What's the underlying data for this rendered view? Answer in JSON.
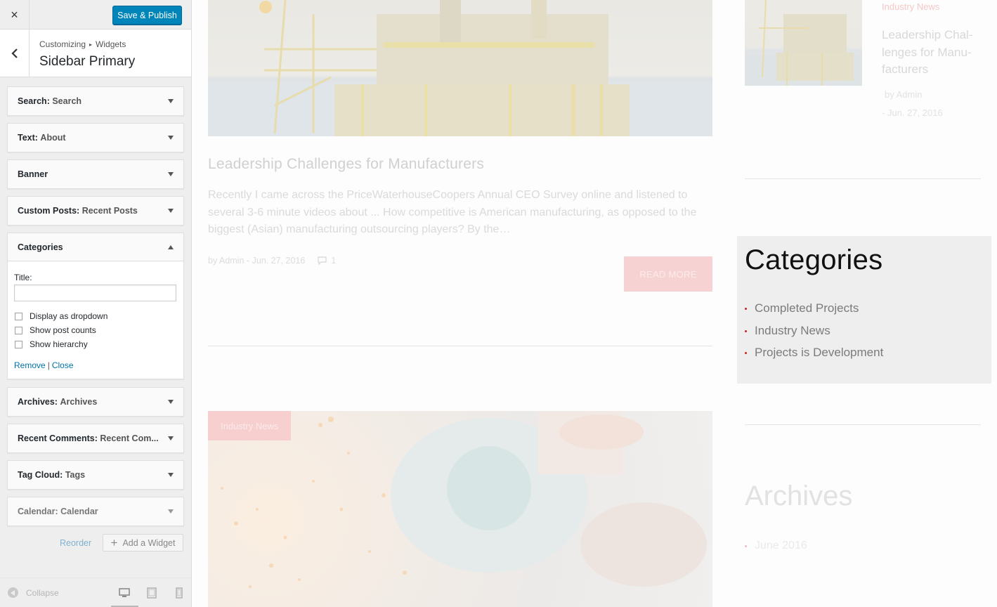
{
  "panel": {
    "header": {
      "close_label": "×",
      "save_label": "Save & Publish"
    },
    "breadcrumb": {
      "root": "Customizing",
      "separator": "▸",
      "current": "Widgets"
    },
    "section_title": "Sidebar Primary",
    "widgets": [
      {
        "type": "Search:",
        "title": "Search",
        "expanded": false
      },
      {
        "type": "Text:",
        "title": "About",
        "expanded": false
      },
      {
        "type": "Banner",
        "title": "",
        "expanded": false
      },
      {
        "type": "Custom Posts:",
        "title": "Recent Posts",
        "expanded": false
      },
      {
        "type": "Categories",
        "title": "",
        "expanded": true
      },
      {
        "type": "Archives:",
        "title": "Archives",
        "expanded": false
      },
      {
        "type": "Recent Comments:",
        "title": "Recent Com...",
        "expanded": false
      },
      {
        "type": "Tag Cloud:",
        "title": "Tags",
        "expanded": false
      },
      {
        "type": "Calendar:",
        "title": "Calendar",
        "expanded": false
      }
    ],
    "categories_form": {
      "title_label": "Title:",
      "title_value": "",
      "options": [
        {
          "label": "Display as dropdown",
          "checked": false
        },
        {
          "label": "Show post counts",
          "checked": false
        },
        {
          "label": "Show hierarchy",
          "checked": false
        }
      ],
      "remove_label": "Remove",
      "separator": "|",
      "close_label": "Close"
    },
    "reorder_label": "Reorder",
    "add_widget_label": "Add a Widget",
    "footer": {
      "collapse_label": "Collapse",
      "devices": [
        "desktop-icon",
        "tablet-icon",
        "mobile-icon"
      ],
      "active_device": "desktop"
    }
  },
  "preview": {
    "post": {
      "title": "Leadership Challenges for Manufacturers",
      "excerpt": "Recently I came across the PriceWaterhouseCoopers Annual CEO Survey online and listened to several 3-6 minute videos about ... How competitive is American manufacturing, as opposed to the biggest (Asian) manufacturing outsourcing players? By the…",
      "author": "by Admin",
      "meta_separator": "-",
      "date": "Jun. 27, 2016",
      "comments": "1",
      "read_more": "READ MORE"
    },
    "second_post": {
      "category_badge": "Industry News"
    },
    "sidebar_post": {
      "category": "Industry News",
      "title": "Leadership Chal- lenges for Manu- facturers",
      "author": "by Admin",
      "date": "- Jun. 27, 2016"
    },
    "categories_widget": {
      "heading": "Categories",
      "items": [
        "Completed Projects",
        "Industry News",
        "Projects is Development"
      ]
    },
    "archives_widget": {
      "heading": "Archives",
      "items": [
        "June 2016"
      ]
    }
  },
  "colors": {
    "primary_button": "#0085ba",
    "accent_red": "#cc2222",
    "link_blue": "#0073aa"
  }
}
